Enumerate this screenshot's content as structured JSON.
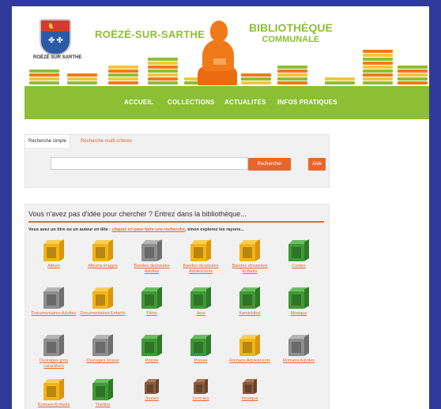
{
  "header": {
    "town": "ROËZÉ-SUR-SARTHE",
    "crest_caption": "ROËZÉ SUR SARTHE",
    "library_title": "BIBLIOTHÈQUE",
    "library_subtitle": "COMMUNALE"
  },
  "nav": {
    "items": [
      {
        "label": "ACCUEIL"
      },
      {
        "label": "COLLECTIONS"
      },
      {
        "label": "ACTUALITÉS"
      },
      {
        "label": "INFOS PRATIQUES"
      }
    ]
  },
  "search": {
    "tab_simple": "Recherche simple",
    "tab_multi": "Recherche multi-critères",
    "input_value": "",
    "search_button": "Rechercher",
    "help_button": "Aide"
  },
  "browse": {
    "title": "Vous n'avez pas d'idée pour chercher ? Entrez dans la bibliothèque...",
    "intro_prefix": "Vous avez un titre ou un auteur en tête : ",
    "intro_link": "cliquez ici pour faire une recherche",
    "intro_suffix": ", sinon explorez les rayons...",
    "shelves": [
      {
        "label": "Album",
        "color": "yellow"
      },
      {
        "label": "Albums images",
        "color": "yellow"
      },
      {
        "label": "Bandes dessinées Adultes",
        "color": "gray"
      },
      {
        "label": "Bandes dessinées Adolescents",
        "color": "yellow"
      },
      {
        "label": "Bandes dessinées Enfants",
        "color": "yellow"
      },
      {
        "label": "Contes",
        "color": "green"
      },
      {
        "label": "Documentaires Adultes",
        "color": "gray"
      },
      {
        "label": "Documentaires Enfants",
        "color": "yellow"
      },
      {
        "label": "Films",
        "color": "green"
      },
      {
        "label": "Jeux",
        "color": "green"
      },
      {
        "label": "Kamishibaï",
        "color": "green"
      },
      {
        "label": "Musique",
        "color": "green"
      },
      {
        "label": "Ouvrages gros caractères",
        "color": "gray"
      },
      {
        "label": "Ouvrages locaux",
        "color": "gray"
      },
      {
        "label": "Poésie",
        "color": "green"
      },
      {
        "label": "Presse",
        "color": "green"
      },
      {
        "label": "Romans Adolescents",
        "color": "yellow"
      },
      {
        "label": "Romans Adultes",
        "color": "gray"
      },
      {
        "label": "Romans Enfants",
        "color": "yellow"
      },
      {
        "label": "Théâtre",
        "color": "green"
      },
      {
        "label": "Jeunes",
        "color": "brown"
      },
      {
        "label": "Livre-jeu",
        "color": "brown"
      },
      {
        "label": "musique",
        "color": "brown"
      }
    ]
  },
  "colors": {
    "background": "#2f3b9a",
    "nav_green": "#8cbf34",
    "accent_orange": "#e8662c"
  }
}
